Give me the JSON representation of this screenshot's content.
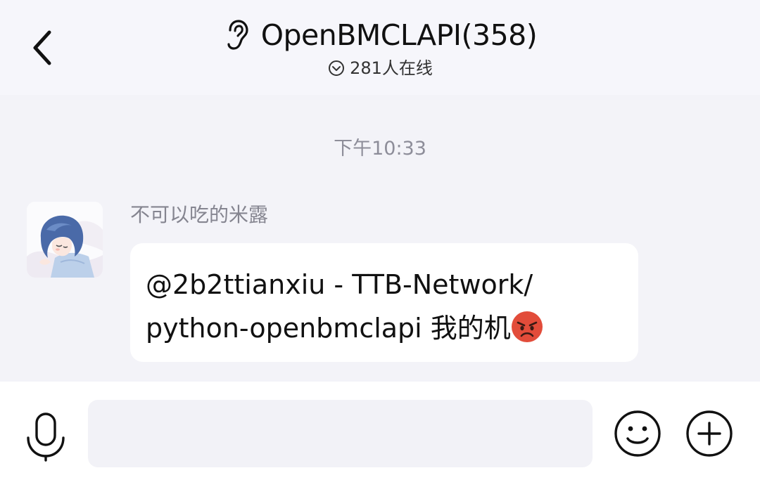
{
  "header": {
    "back_icon": "chevron-left-icon",
    "mode_icon": "ear-icon",
    "title": "OpenBMCLAPI(358)",
    "online_icon": "chevron-down-circle-icon",
    "online_text": "281人在线"
  },
  "chat": {
    "timestamp": "下午10:33",
    "messages": [
      {
        "sender": "不可以吃的米露",
        "avatar": "anime-avatar",
        "lines": [
          "@2b2ttianxiu - TTB-Network/",
          "python-openbmclapi 我的机"
        ],
        "trailing_emoji": "angry-face-emoji"
      }
    ]
  },
  "input_bar": {
    "voice_icon": "microphone-icon",
    "input_value": "",
    "emoji_icon": "smiley-icon",
    "more_icon": "plus-circle-icon"
  },
  "colors": {
    "background": "#f3f3f8",
    "header_background": "#f6f6fb",
    "bubble": "#ffffff",
    "muted_text": "#8d8d99"
  }
}
